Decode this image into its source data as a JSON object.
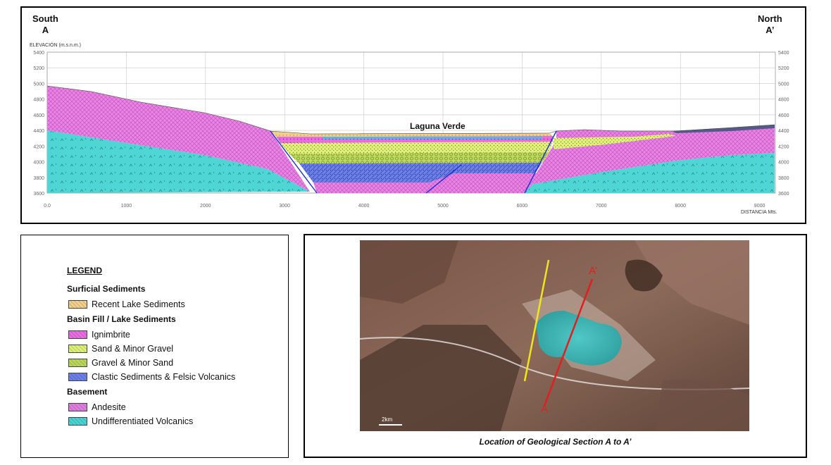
{
  "section": {
    "south_label": "South",
    "south_point": "A",
    "north_label": "North",
    "north_point": "A’",
    "y_axis_label": "ELEVACIÓN  (m.s.n.m.)",
    "x_axis_label": "DISTANCIA  Mts.",
    "lake_label": "Laguna Verde",
    "y_ticks": [
      "5400",
      "5200",
      "5000",
      "4800",
      "4600",
      "4400",
      "4200",
      "4000",
      "3800",
      "3600"
    ],
    "x_ticks": [
      "0.0",
      "1000",
      "2000",
      "3000",
      "4000",
      "5000",
      "6000",
      "7000",
      "8000",
      "9000"
    ]
  },
  "legend": {
    "title": "LEGEND",
    "groups": [
      {
        "name": "Surficial Sediments",
        "items": [
          {
            "label": "Recent Lake Sediments",
            "color": "#f2cf8a"
          }
        ]
      },
      {
        "name": "Basin Fill / Lake Sediments",
        "items": [
          {
            "label": "Ignimbrite",
            "color": "#e76de0"
          },
          {
            "label": "Sand & Minor Gravel",
            "color": "#dcef78"
          },
          {
            "label": "Gravel & Minor Sand",
            "color": "#b9d65c"
          },
          {
            "label": "Clastic Sediments & Felsic Volcanics",
            "color": "#6b7fe6"
          }
        ]
      },
      {
        "name": "Basement",
        "items": [
          {
            "label": "Andesite",
            "color": "#e07be0"
          },
          {
            "label": "Undifferentiated Volcanics",
            "color": "#46d4d4"
          }
        ]
      }
    ]
  },
  "map": {
    "caption": "Location of Geological Section A to A’",
    "point_a": "A",
    "point_a_prime": "A’",
    "scale_label": "2km",
    "line_colors": {
      "section": "#e02020",
      "other": "#f2e41c"
    },
    "lake_color": "#3bb6b6"
  }
}
